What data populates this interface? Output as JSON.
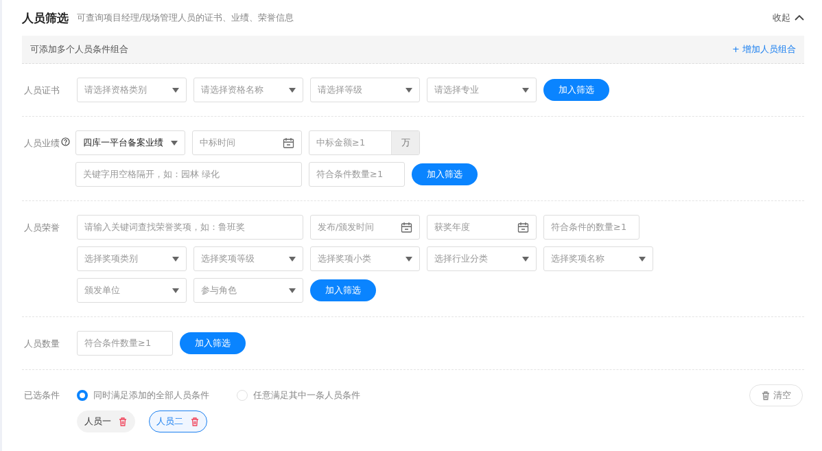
{
  "header": {
    "title": "人员筛选",
    "subtitle": "可查询项目经理/现场管理人员的证书、业绩、荣誉信息",
    "collapse": "收起"
  },
  "combo_bar": {
    "hint": "可添加多个人员条件组合",
    "add_link": "+ 增加人员组合"
  },
  "sections": [
    {
      "label": "人员证书",
      "rows": [
        {
          "controls": [
            {
              "kind": "select",
              "placeholder": "请选择资格类别"
            },
            {
              "kind": "select",
              "placeholder": "请选择资格名称"
            },
            {
              "kind": "select",
              "placeholder": "请选择等级"
            },
            {
              "kind": "select",
              "placeholder": "请选择专业"
            },
            {
              "kind": "button",
              "label": "加入筛选"
            }
          ]
        }
      ]
    },
    {
      "label": "人员业绩",
      "help": true,
      "rows": [
        {
          "controls": [
            {
              "kind": "select",
              "value": "四库一平台备案业绩"
            },
            {
              "kind": "date",
              "placeholder": "中标时间"
            },
            {
              "kind": "amount",
              "placeholder": "中标金额≥1",
              "unit": "万"
            }
          ]
        },
        {
          "controls": [
            {
              "kind": "keyword",
              "placeholder": "关键字用空格隔开，如：园林 绿化"
            },
            {
              "kind": "text",
              "placeholder": "符合条件数量≥1"
            },
            {
              "kind": "button",
              "label": "加入筛选"
            }
          ]
        }
      ]
    },
    {
      "label": "人员荣誉",
      "rows": [
        {
          "controls": [
            {
              "kind": "keyword",
              "placeholder": "请输入关键词查找荣誉奖项，如：鲁班奖"
            },
            {
              "kind": "date",
              "placeholder": "发布/颁发时间"
            },
            {
              "kind": "date",
              "placeholder": "获奖年度"
            },
            {
              "kind": "text",
              "placeholder": "符合条件的数量≥1"
            }
          ]
        },
        {
          "controls": [
            {
              "kind": "select",
              "placeholder": "选择奖项类别"
            },
            {
              "kind": "select",
              "placeholder": "选择奖项等级"
            },
            {
              "kind": "select",
              "placeholder": "选择奖项小类"
            },
            {
              "kind": "select",
              "placeholder": "选择行业分类"
            },
            {
              "kind": "select",
              "placeholder": "选择奖项名称"
            }
          ]
        },
        {
          "controls": [
            {
              "kind": "select",
              "placeholder": "颁发单位"
            },
            {
              "kind": "select",
              "placeholder": "参与角色"
            },
            {
              "kind": "button",
              "label": "加入筛选"
            }
          ]
        }
      ]
    },
    {
      "label": "人员数量",
      "rows": [
        {
          "controls": [
            {
              "kind": "text",
              "placeholder": "符合条件数量≥1"
            },
            {
              "kind": "button",
              "label": "加入筛选"
            }
          ]
        }
      ]
    }
  ],
  "selected_conditions": {
    "label": "已选条件",
    "modes": [
      {
        "label": "同时满足添加的全部人员条件",
        "selected": true
      },
      {
        "label": "任意满足其中一条人员条件",
        "selected": false
      }
    ],
    "clear": "清空",
    "tags": [
      {
        "label": "人员一",
        "selected": false
      },
      {
        "label": "人员二",
        "selected": true
      }
    ]
  }
}
